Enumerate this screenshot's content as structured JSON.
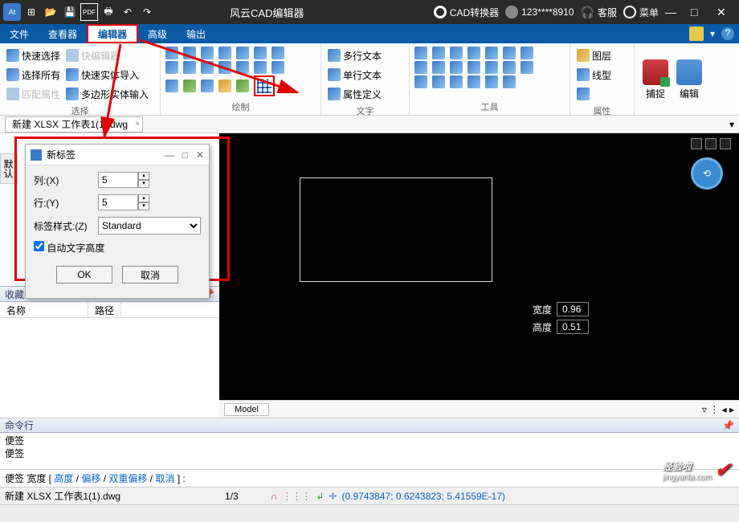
{
  "titlebar": {
    "app_title": "风云CAD编辑器",
    "converter": "CAD转换器",
    "user": "123****8910",
    "support": "客服",
    "menu": "菜单"
  },
  "menubar": {
    "file": "文件",
    "viewer": "查看器",
    "editor": "编辑器",
    "advanced": "高级",
    "output": "输出"
  },
  "ribbon": {
    "select": {
      "quick": "快速选择",
      "all": "选择所有",
      "match": "匹配属性",
      "quick_editor": "快编辑器",
      "import_solid": "快速实体导入",
      "poly_input": "多边形实体输入",
      "label": "选择"
    },
    "draw": {
      "label": "绘制"
    },
    "text": {
      "mtext": "多行文本",
      "stext": "单行文本",
      "attr": "属性定义",
      "label": "文字"
    },
    "tools": {
      "label": "工具"
    },
    "props": {
      "layer": "图层",
      "ltype": "线型",
      "label": "属性"
    },
    "capture": "捕捉",
    "edit": "编辑"
  },
  "file_tab": "新建 XLSX 工作表1(1).dwg",
  "side_tab": "默认",
  "dialog": {
    "title": "新标签",
    "cols_label": "列:(X)",
    "cols_val": "5",
    "rows_label": "行:(Y)",
    "rows_val": "5",
    "style_label": "标签样式:(Z)",
    "style_val": "Standard",
    "auto_height": "自动文字高度",
    "ok": "OK",
    "cancel": "取消"
  },
  "favorites": {
    "title": "收藏夹",
    "col_name": "名称",
    "col_path": "路径"
  },
  "canvas": {
    "width_label": "宽度",
    "width_val": "0.96",
    "height_label": "高度",
    "height_val": "0.51"
  },
  "model_tab": "Model",
  "cmd": {
    "title": "命令行",
    "line1": "便签",
    "line2": "便签",
    "prompt_prefix": "便签 宽度 [",
    "opt_height": "高度",
    "opt_offset": "偏移",
    "opt_double": "双重偏移",
    "opt_cancel": "取消",
    "prompt_suffix": "] :"
  },
  "status": {
    "filename": "新建 XLSX 工作表1(1).dwg",
    "page": "1/3",
    "coords": "(0.9743847; 0.6243823; 5.41559E-17)"
  },
  "watermark": {
    "main": "经验啦",
    "sub": "jingyanla.com"
  }
}
